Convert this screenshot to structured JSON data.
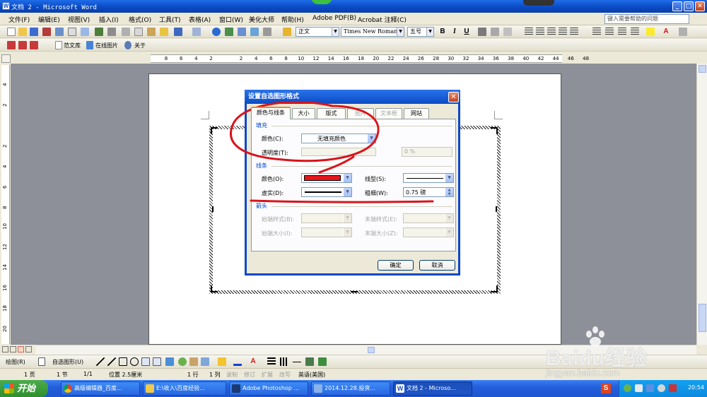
{
  "window": {
    "title": "文档 2 - Microsoft Word",
    "min": "_",
    "max": "□",
    "close": "✕"
  },
  "menu": {
    "items": [
      "文件(F)",
      "编辑(E)",
      "视图(V)",
      "插入(I)",
      "格式(O)",
      "工具(T)",
      "表格(A)",
      "窗口(W)",
      "美化大师",
      "帮助(H)",
      "Adobe PDF(B)",
      "Acrobat 注释(C)"
    ],
    "help_placeholder": "键入需要帮助的问题"
  },
  "format_toolbar": {
    "style": "正文",
    "font": "Times New Roman",
    "size": "五号",
    "bold": "B",
    "italic": "I",
    "underline": "U"
  },
  "toolbar3": {
    "items": [
      "范文库",
      "在线图片",
      "关于"
    ]
  },
  "ruler": {
    "h_ticks": [
      "8",
      "6",
      "4",
      "2",
      "",
      "2",
      "4",
      "6",
      "8",
      "10",
      "12",
      "14",
      "16",
      "18",
      "20",
      "22",
      "24",
      "26",
      "28",
      "30",
      "32",
      "34",
      "36",
      "38",
      "40",
      "42",
      "44",
      "46",
      "48"
    ],
    "v_ticks": [
      "4",
      "2",
      "",
      "2",
      "4",
      "6",
      "8",
      "10",
      "12",
      "14",
      "16",
      "18",
      "20"
    ]
  },
  "dialog": {
    "title": "设置自选图形格式",
    "close": "✕",
    "tabs": [
      "颜色与线条",
      "大小",
      "版式",
      "图片",
      "文本框",
      "网站"
    ],
    "fill": {
      "group": "填充",
      "color_label": "颜色(C):",
      "color_value": "无填充颜色",
      "transparency_label": "透明度(T):",
      "transparency_value": "0 %"
    },
    "line": {
      "group": "线条",
      "color_label": "颜色(O):",
      "style_label": "线型(S):",
      "dash_label": "虚实(D):",
      "weight_label": "粗细(W):",
      "weight_value": "0.75 磅"
    },
    "arrows": {
      "group": "箭头",
      "begin_style": "始端样式(B):",
      "end_style": "末端样式(E):",
      "begin_size": "始端大小(I):",
      "end_size": "末端大小(Z):"
    },
    "ok": "确定",
    "cancel": "取消"
  },
  "drawbar": {
    "draw": "绘图(R)",
    "autoshapes": "自选图形(U)"
  },
  "status": {
    "page": "1 页",
    "section": "1 节",
    "pages": "1/1",
    "position": "位置 2.5厘米",
    "line": "1 行",
    "col": "1 列",
    "rec": "录制",
    "trk": "修订",
    "ext": "扩展",
    "ovr": "改写",
    "lang": "英语(美国)"
  },
  "taskbar": {
    "start": "开始",
    "buttons": [
      "高级编辑器_百度...",
      "E:\\收入\\百度经验...",
      "Adobe Photoshop ...",
      "2014.12.28.投资...",
      "文档 2 - Microso..."
    ],
    "clock": "20:54"
  },
  "watermark": {
    "logo": "Baidu经验",
    "url": "jingyan.baidu.com"
  },
  "colors": {
    "line_color": "#e8151b",
    "annotation": "#d9141b",
    "title_blue": "#0a4bc5"
  }
}
